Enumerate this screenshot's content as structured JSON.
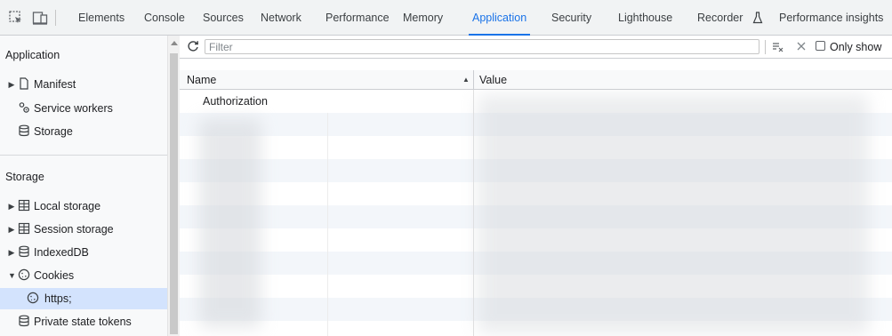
{
  "tabs": [
    {
      "label": "Elements",
      "active": false
    },
    {
      "label": "Console",
      "active": false
    },
    {
      "label": "Sources",
      "active": false
    },
    {
      "label": "Network",
      "active": false
    },
    {
      "label": "Performance",
      "active": false
    },
    {
      "label": "Memory",
      "active": false
    },
    {
      "label": "Application",
      "active": true
    },
    {
      "label": "Security",
      "active": false
    },
    {
      "label": "Lighthouse",
      "active": false
    },
    {
      "label": "Recorder",
      "active": false
    },
    {
      "label": "Performance insights",
      "active": false
    }
  ],
  "sidebar": {
    "application": {
      "title": "Application",
      "items": [
        {
          "label": "Manifest"
        },
        {
          "label": "Service workers"
        },
        {
          "label": "Storage"
        }
      ]
    },
    "storage": {
      "title": "Storage",
      "items": [
        {
          "label": "Local storage"
        },
        {
          "label": "Session storage"
        },
        {
          "label": "IndexedDB"
        },
        {
          "label": "Cookies"
        },
        {
          "label": "https;"
        },
        {
          "label": "Private state tokens"
        }
      ]
    }
  },
  "toolbar": {
    "filter_placeholder": "Filter",
    "only_show_label": "Only show"
  },
  "grid": {
    "columns": [
      {
        "label": "Name"
      },
      {
        "label": "Value"
      }
    ],
    "rows": [
      {
        "name": "Authorization"
      }
    ]
  },
  "colors": {
    "accent": "#1a73e8",
    "selected_bg": "#d3e3fd"
  }
}
